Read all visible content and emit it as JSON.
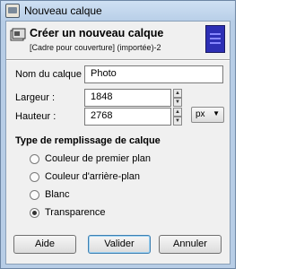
{
  "window": {
    "title": "Nouveau calque"
  },
  "header": {
    "title": "Créer un nouveau calque",
    "subtitle": "[Cadre pour couverture] (importée)-2"
  },
  "form": {
    "name_label": "Nom du calque :",
    "name_value": "Photo",
    "width_label": "Largeur :",
    "width_value": "1848",
    "height_label": "Hauteur :",
    "height_value": "2768",
    "unit": "px"
  },
  "fill": {
    "title": "Type de remplissage de calque",
    "options": [
      {
        "label": "Couleur de premier plan",
        "checked": false
      },
      {
        "label": "Couleur d'arrière-plan",
        "checked": false
      },
      {
        "label": "Blanc",
        "checked": false
      },
      {
        "label": "Transparence",
        "checked": true
      }
    ]
  },
  "buttons": {
    "help": "Aide",
    "ok": "Valider",
    "cancel": "Annuler"
  }
}
